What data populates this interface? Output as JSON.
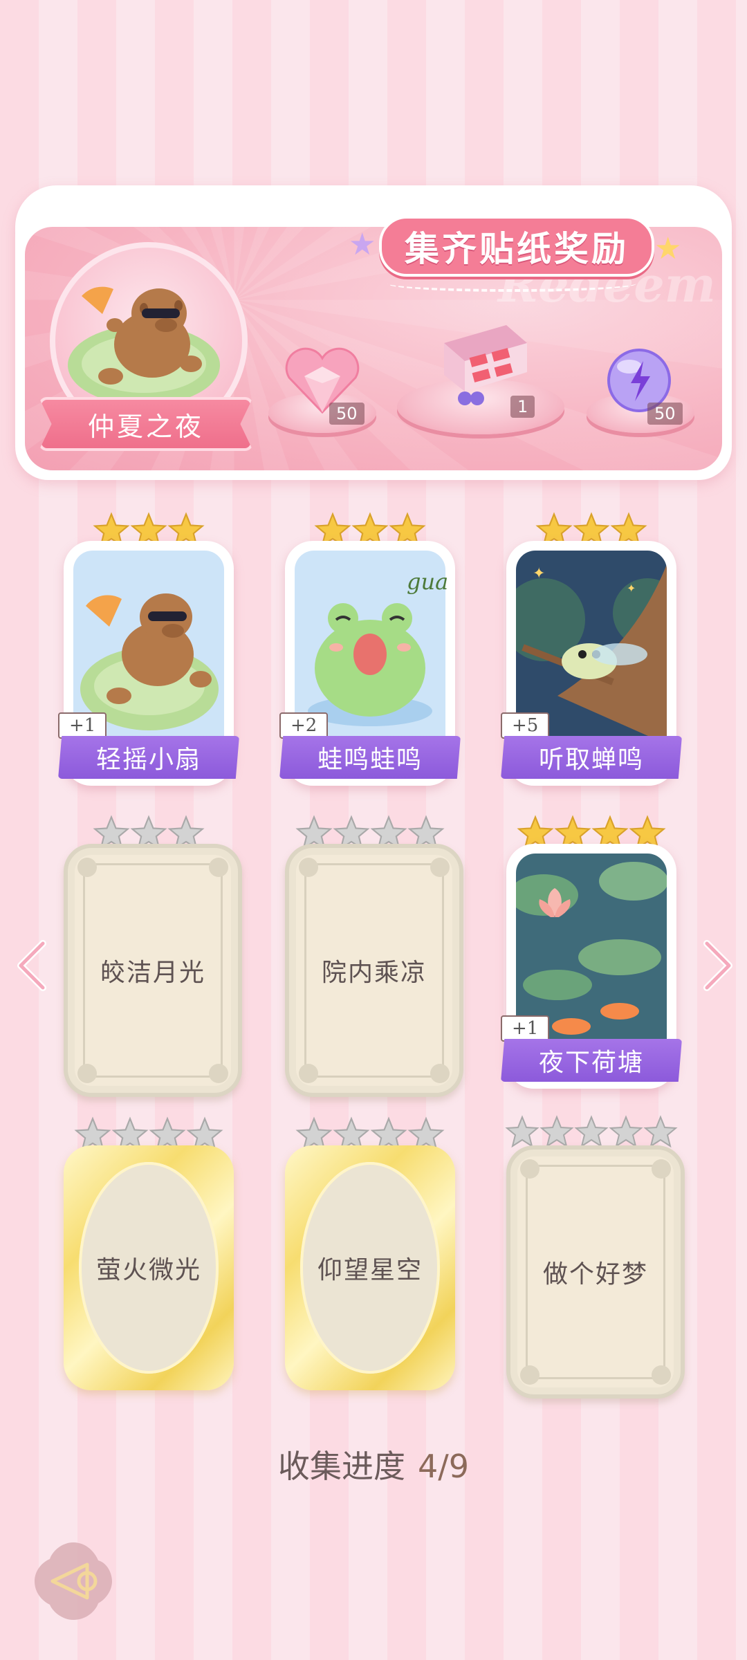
{
  "banner": {
    "title": "集齐贴纸奖励",
    "watermark": "Redeem",
    "avatar_name": "仲夏之夜",
    "rewards": [
      {
        "icon": "heart-gem-icon",
        "qty": "50"
      },
      {
        "icon": "gift-box-icon",
        "qty": "1"
      },
      {
        "icon": "energy-orb-icon",
        "qty": "50"
      }
    ]
  },
  "cards": [
    {
      "title": "轻摇小扇",
      "stars": 3,
      "star_color": "gold",
      "state": "unlocked",
      "count": "+1",
      "icon": "capybara-fan-icon"
    },
    {
      "title": "蛙鸣蛙鸣",
      "stars": 3,
      "star_color": "gold",
      "state": "unlocked",
      "count": "+2",
      "icon": "frog-icon",
      "art_text": "gua"
    },
    {
      "title": "听取蝉鸣",
      "stars": 3,
      "star_color": "gold",
      "state": "unlocked",
      "count": "+5",
      "icon": "cicada-icon"
    },
    {
      "title": "皎洁月光",
      "stars": 3,
      "star_color": "silver",
      "state": "locked"
    },
    {
      "title": "院内乘凉",
      "stars": 4,
      "star_color": "silver",
      "state": "locked"
    },
    {
      "title": "夜下荷塘",
      "stars": 4,
      "star_color": "gold",
      "state": "unlocked",
      "count": "+1",
      "icon": "lotus-pond-icon"
    },
    {
      "title": "萤火微光",
      "stars": 4,
      "star_color": "silver",
      "state": "gold-locked"
    },
    {
      "title": "仰望星空",
      "stars": 4,
      "star_color": "silver",
      "state": "gold-locked"
    },
    {
      "title": "做个好梦",
      "stars": 5,
      "star_color": "silver",
      "state": "locked"
    }
  ],
  "progress": {
    "label": "收集进度",
    "value": "4/9"
  },
  "colors": {
    "gold_star": "#f7c843",
    "silver_star": "#c9c9c9",
    "label_purple": "#9a66e2",
    "pink_accent": "#f47d96"
  }
}
